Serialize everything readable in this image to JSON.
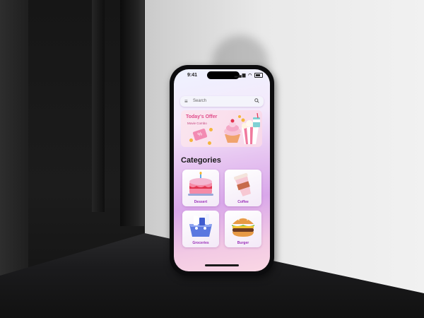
{
  "status_bar": {
    "time": "9:41"
  },
  "search": {
    "placeholder": "Search"
  },
  "offer": {
    "title": "Today's Offer",
    "subtitle": "Movie Combo",
    "badge": "%"
  },
  "categories": {
    "heading": "Categories",
    "items": [
      {
        "label": "Dessert",
        "icon": "cake-icon"
      },
      {
        "label": "Coffee",
        "icon": "coffee-cup-icon"
      },
      {
        "label": "Groceries",
        "icon": "groceries-icon"
      },
      {
        "label": "Burger",
        "icon": "burger-icon"
      }
    ]
  },
  "colors": {
    "accent_pink": "#e04c8a",
    "category_purple": "#9a2fb8",
    "screen_gradient_mid": "#d9a7ea"
  }
}
